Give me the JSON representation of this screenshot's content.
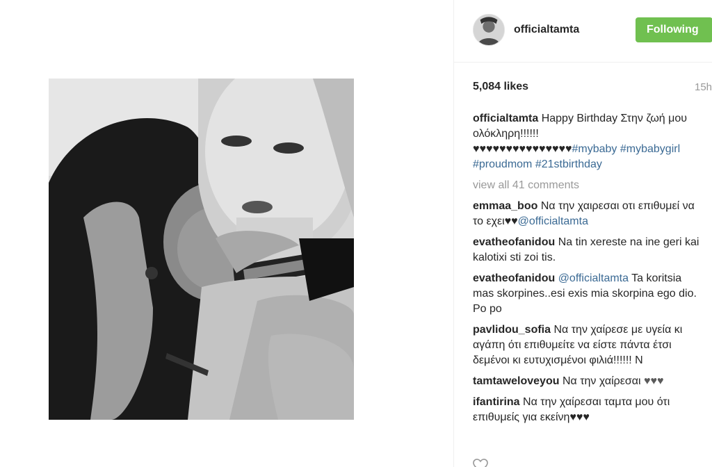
{
  "post": {
    "username": "officialtamta",
    "follow_label": "Following",
    "likes": "5,084 likes",
    "time_ago": "15h"
  },
  "caption": {
    "user": "officialtamta",
    "text": "Happy Birthday Στην ζωή μου ολόκληρη!!!!!!",
    "hearts": "♥♥♥♥♥♥♥♥♥♥♥♥♥♥♥",
    "hashtags": [
      "#mybaby",
      "#mybabygirl",
      "#proudmom",
      "#21stbirthday"
    ]
  },
  "view_all": "view all 41 comments",
  "comments": [
    {
      "user": "emmaa_boo",
      "text": "Να την χαιρεσαι οτι επιθυμεί να το εχει",
      "hearts": "♥♥",
      "mention": "@officialtamta"
    },
    {
      "user": "evatheofanidou",
      "text": "Na tin xereste na ine geri kai kalotixi sti zoi tis."
    },
    {
      "user": "evatheofanidou",
      "mention": "@officialtamta",
      "text": "Ta koritsia mas skorpines..esi exis mia skorpina ego dio. Po po"
    },
    {
      "user": "pavlidou_sofia",
      "text": "Να την χαίρεσε με υγεία κι αγάπη ότι επιθυμείτε να είστε πάντα έτσι δεμένοι κι ευτυχισμένοι φιλιά!!!!!! Ν"
    },
    {
      "user": "tamtaweloveyou",
      "text": "Να την χαίρεσαι",
      "hearts": "♥♥♥"
    },
    {
      "user": "ifantirina",
      "text": "Να την χαίρεσαι ταμτα μου ότι επιθυμείς για εκείνη♥♥♥"
    }
  ],
  "icons": {
    "like": "heart-outline-icon",
    "avatar": "user-avatar"
  },
  "colors": {
    "follow_button": "#70c050",
    "hashtag": "#3b6a94",
    "muted": "#999999"
  }
}
